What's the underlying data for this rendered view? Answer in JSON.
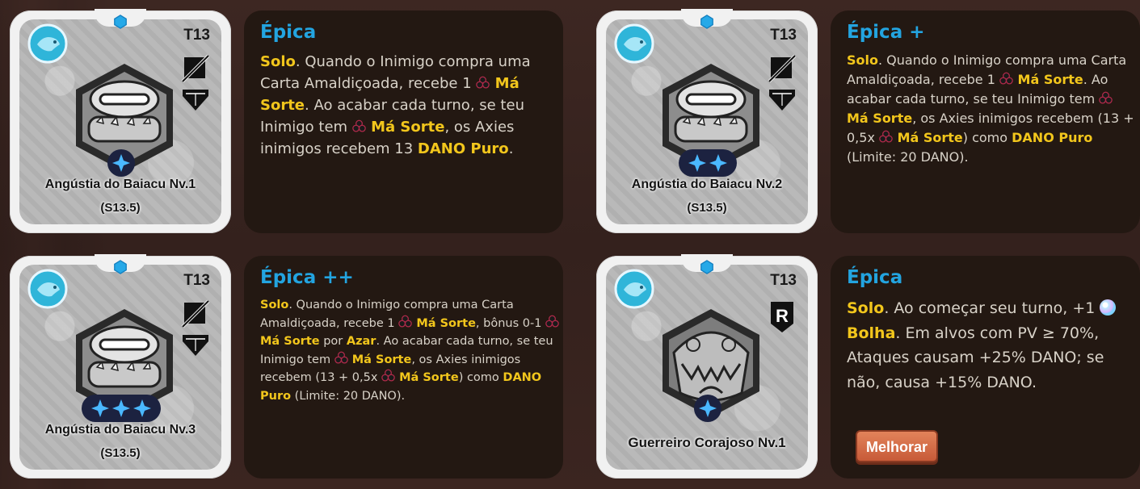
{
  "cards": [
    {
      "tier": "T13",
      "name": "Angústia do Baiacu Nv.1",
      "season": "(S13.5)",
      "level": 1,
      "rarity": "Épica",
      "desc": [
        {
          "t": "Solo",
          "k": 1
        },
        {
          "t": ". Quando o Inimigo compra uma Carta Amaldiçoada, recebe 1 "
        },
        {
          "c": 1
        },
        {
          "t": " Má Sorte",
          "k": 1
        },
        {
          "t": ". Ao acabar cada turno, se teu Inimigo tem "
        },
        {
          "c": 1
        },
        {
          "t": " Má Sorte",
          "k": 1
        },
        {
          "t": ", os Axies inimigos recebem 13 "
        },
        {
          "t": "DANO Puro",
          "k": 1
        },
        {
          "t": "."
        }
      ]
    },
    {
      "tier": "T13",
      "name": "Angústia do Baiacu Nv.2",
      "season": "(S13.5)",
      "level": 2,
      "rarity": "Épica +",
      "desc": [
        {
          "t": "Solo",
          "k": 1
        },
        {
          "t": ". Quando o Inimigo compra uma Carta Amaldiçoada, recebe 1 "
        },
        {
          "c": 1
        },
        {
          "t": " Má Sorte",
          "k": 1
        },
        {
          "t": ". Ao acabar cada turno, se teu Inimigo tem "
        },
        {
          "c": 1
        },
        {
          "t": " Má Sorte",
          "k": 1
        },
        {
          "t": ", os Axies inimigos recebem (13 + 0,5x "
        },
        {
          "c": 1
        },
        {
          "t": " Má Sorte",
          "k": 1
        },
        {
          "t": ") como "
        },
        {
          "t": "DANO Puro",
          "k": 1
        },
        {
          "t": " (Limite: 20 DANO)."
        }
      ]
    },
    {
      "tier": "T13",
      "name": "Angústia do Baiacu Nv.3",
      "season": "(S13.5)",
      "level": 3,
      "rarity": "Épica ++",
      "desc": [
        {
          "t": "Solo",
          "k": 1
        },
        {
          "t": ". Quando o Inimigo compra uma Carta Amaldiçoada, recebe 1 "
        },
        {
          "c": 1
        },
        {
          "t": " Má Sorte",
          "k": 1
        },
        {
          "t": ", bônus 0-1 "
        },
        {
          "c": 1
        },
        {
          "t": " Má Sorte",
          "k": 1
        },
        {
          "t": " por "
        },
        {
          "t": "Azar",
          "k": 1
        },
        {
          "t": ". Ao acabar cada turno, se teu Inimigo tem "
        },
        {
          "c": 1
        },
        {
          "t": " Má Sorte",
          "k": 1
        },
        {
          "t": ", os Axies inimigos recebem (13 + 0,5x "
        },
        {
          "c": 1
        },
        {
          "t": " Má Sorte",
          "k": 1
        },
        {
          "t": ") como "
        },
        {
          "t": "DANO Puro",
          "k": 1
        },
        {
          "t": " (Limite: 20 DANO)."
        }
      ]
    },
    {
      "tier": "T13",
      "name": "Guerreiro Corajoso Nv.1",
      "season": "",
      "level": 1,
      "rarity": "Épica",
      "desc": [
        {
          "t": "Solo",
          "k": 1
        },
        {
          "t": ". Ao começar seu turno, +1 "
        },
        {
          "b": 1
        },
        {
          "t": " Bolha",
          "k": 1
        },
        {
          "t": ". Em alvos com PV ≥ 70%, Ataques causam +25% DANO; se não, causa +15% DANO."
        }
      ],
      "button": "Melhorar"
    }
  ],
  "colors": {
    "rarity": "#23a4e0",
    "keyword": "#f2c61c",
    "body_text": "#d8d2c8",
    "panel": "#231812",
    "card": "#f1f1f1"
  },
  "icons": [
    "gem-icon",
    "aquatic-class-icon",
    "no-attack-icon",
    "defense-shield-icon",
    "ranged-icon",
    "level-star-icon",
    "clover-icon",
    "bubble-icon"
  ]
}
